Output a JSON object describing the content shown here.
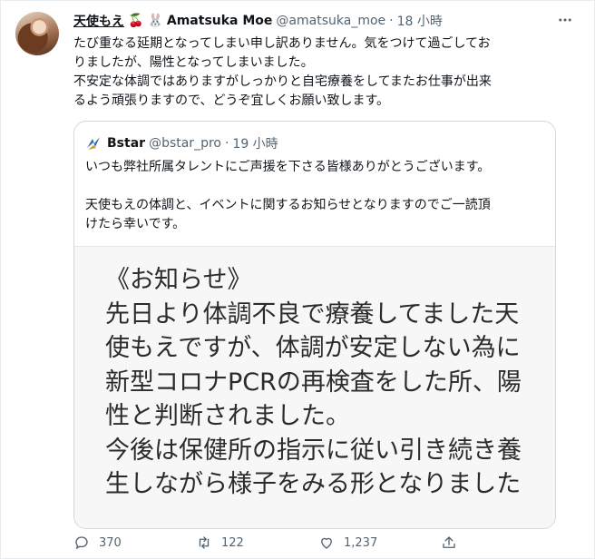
{
  "tweet": {
    "display_name": "天使もえ",
    "emoji_1": "🍒",
    "emoji_2": "🐰",
    "name_suffix": "Amatsuka Moe",
    "handle": "@amatsuka_moe",
    "separator": "·",
    "time": "18 小時",
    "more_icon": "more-icon",
    "text": "たび重なる延期となってしまい申し訳ありません。気をつけて過ごしてお\nりましたが、陽性となってしまいました。\n不安定な体調ではありますがしっかりと自宅療養をしてまたお仕事が出来\nるよう頑張りますので、どうぞ宜しくお願い致します。"
  },
  "quote": {
    "name": "Bstar",
    "handle": "@bstar_pro",
    "separator": "·",
    "time": "19 小時",
    "text": "いつも弊社所属タレントにご声援を下さる皆様ありがとうございます。\n\n天使もえの体調と、イベントに関するお知らせとなりますのでご一読頂\nけたら幸いです。",
    "image_text": "《お知らせ》\n先日より体調不良で療養してました天\n使もえですが、体調が安定しない為に\n新型コロナPCRの再検査をした所、陽\n性と判断されました。\n今後は保健所の指示に従い引き続き養\n生しながら様子をみる形となりました"
  },
  "actions": {
    "reply_count": "370",
    "retweet_count": "122",
    "like_count": "1,237",
    "icons": [
      "reply-icon",
      "retweet-icon",
      "like-icon",
      "share-icon"
    ]
  },
  "colors": {
    "text": "#0f1419",
    "secondary": "#536471",
    "border": "#cfd9de"
  }
}
